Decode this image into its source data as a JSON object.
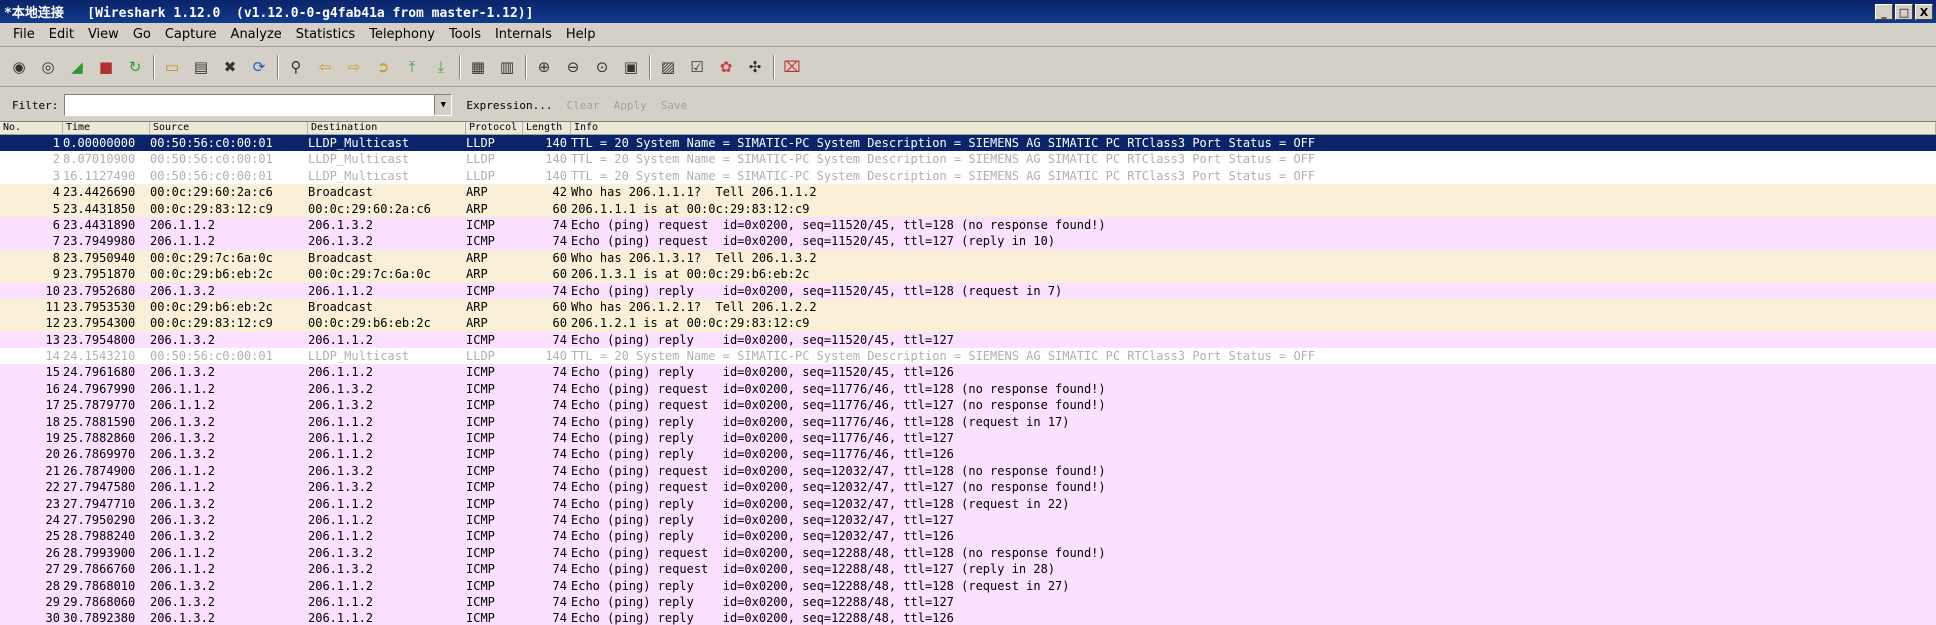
{
  "window": {
    "title": "*本地连接   [Wireshark 1.12.0  (v1.12.0-0-g4fab41a from master-1.12)]",
    "minimize": "_",
    "maximize": "□",
    "close": "X"
  },
  "menu": [
    "File",
    "Edit",
    "View",
    "Go",
    "Capture",
    "Analyze",
    "Statistics",
    "Telephony",
    "Tools",
    "Internals",
    "Help"
  ],
  "toolbar": {
    "icons": [
      "interfaces-icon",
      "options-icon",
      "start-capture-icon",
      "stop-capture-icon",
      "restart-capture-icon",
      "open-file-icon",
      "save-file-icon",
      "close-file-icon",
      "reload-icon",
      "find-icon",
      "go-back-icon",
      "go-forward-icon",
      "go-to-packet-icon",
      "first-packet-icon",
      "last-packet-icon",
      "colorize-icon",
      "autoscroll-icon",
      "zoom-in-icon",
      "zoom-out-icon",
      "normal-size-icon",
      "resize-columns-icon",
      "capture-filters-icon",
      "display-filters-icon",
      "coloring-rules-icon",
      "preferences-icon",
      "help-icon"
    ]
  },
  "filter": {
    "label": "Filter:",
    "value": "",
    "expression": "Expression...",
    "clear": "Clear",
    "apply": "Apply",
    "save": "Save"
  },
  "packet_list": {
    "columns": [
      "No.",
      "Time",
      "Source",
      "Destination",
      "Protocol",
      "Length",
      "Info"
    ],
    "colors": {
      "selected_bg": "#0a246a",
      "selected_fg": "#ffffff",
      "lldp_fg": "#b0b0b0",
      "arp_bg": "#faf0d7",
      "icmp_bg": "#fce0ff"
    },
    "rows": [
      {
        "no": "1",
        "time": "0.00000000",
        "src": "00:50:56:c0:00:01",
        "dst": "LLDP_Multicast",
        "proto": "LLDP",
        "len": "140",
        "info": "TTL = 20 System Name = SIMATIC-PC System Description = SIEMENS AG SIMATIC PC RTClass3 Port Status = OFF",
        "style": "selected"
      },
      {
        "no": "2",
        "time": "8.07010900",
        "src": "00:50:56:c0:00:01",
        "dst": "LLDP_Multicast",
        "proto": "LLDP",
        "len": "140",
        "info": "TTL = 20 System Name = SIMATIC-PC System Description = SIEMENS AG SIMATIC PC RTClass3 Port Status = OFF",
        "style": "lldp"
      },
      {
        "no": "3",
        "time": "16.1127490",
        "src": "00:50:56:c0:00:01",
        "dst": "LLDP_Multicast",
        "proto": "LLDP",
        "len": "140",
        "info": "TTL = 20 System Name = SIMATIC-PC System Description = SIEMENS AG SIMATIC PC RTClass3 Port Status = OFF",
        "style": "lldp"
      },
      {
        "no": "4",
        "time": "23.4426690",
        "src": "00:0c:29:60:2a:c6",
        "dst": "Broadcast",
        "proto": "ARP",
        "len": "42",
        "info": "Who has 206.1.1.1?  Tell 206.1.1.2",
        "style": "arp"
      },
      {
        "no": "5",
        "time": "23.4431850",
        "src": "00:0c:29:83:12:c9",
        "dst": "00:0c:29:60:2a:c6",
        "proto": "ARP",
        "len": "60",
        "info": "206.1.1.1 is at 00:0c:29:83:12:c9",
        "style": "arp"
      },
      {
        "no": "6",
        "time": "23.4431890",
        "src": "206.1.1.2",
        "dst": "206.1.3.2",
        "proto": "ICMP",
        "len": "74",
        "info": "Echo (ping) request  id=0x0200, seq=11520/45, ttl=128 (no response found!)",
        "style": "icmp"
      },
      {
        "no": "7",
        "time": "23.7949980",
        "src": "206.1.1.2",
        "dst": "206.1.3.2",
        "proto": "ICMP",
        "len": "74",
        "info": "Echo (ping) request  id=0x0200, seq=11520/45, ttl=127 (reply in 10)",
        "style": "icmp"
      },
      {
        "no": "8",
        "time": "23.7950940",
        "src": "00:0c:29:7c:6a:0c",
        "dst": "Broadcast",
        "proto": "ARP",
        "len": "60",
        "info": "Who has 206.1.3.1?  Tell 206.1.3.2",
        "style": "arp"
      },
      {
        "no": "9",
        "time": "23.7951870",
        "src": "00:0c:29:b6:eb:2c",
        "dst": "00:0c:29:7c:6a:0c",
        "proto": "ARP",
        "len": "60",
        "info": "206.1.3.1 is at 00:0c:29:b6:eb:2c",
        "style": "arp"
      },
      {
        "no": "10",
        "time": "23.7952680",
        "src": "206.1.3.2",
        "dst": "206.1.1.2",
        "proto": "ICMP",
        "len": "74",
        "info": "Echo (ping) reply    id=0x0200, seq=11520/45, ttl=128 (request in 7)",
        "style": "icmp"
      },
      {
        "no": "11",
        "time": "23.7953530",
        "src": "00:0c:29:b6:eb:2c",
        "dst": "Broadcast",
        "proto": "ARP",
        "len": "60",
        "info": "Who has 206.1.2.1?  Tell 206.1.2.2",
        "style": "arp"
      },
      {
        "no": "12",
        "time": "23.7954300",
        "src": "00:0c:29:83:12:c9",
        "dst": "00:0c:29:b6:eb:2c",
        "proto": "ARP",
        "len": "60",
        "info": "206.1.2.1 is at 00:0c:29:83:12:c9",
        "style": "arp"
      },
      {
        "no": "13",
        "time": "23.7954800",
        "src": "206.1.3.2",
        "dst": "206.1.1.2",
        "proto": "ICMP",
        "len": "74",
        "info": "Echo (ping) reply    id=0x0200, seq=11520/45, ttl=127",
        "style": "icmp"
      },
      {
        "no": "14",
        "time": "24.1543210",
        "src": "00:50:56:c0:00:01",
        "dst": "LLDP_Multicast",
        "proto": "LLDP",
        "len": "140",
        "info": "TTL = 20 System Name = SIMATIC-PC System Description = SIEMENS AG SIMATIC PC RTClass3 Port Status = OFF",
        "style": "lldp"
      },
      {
        "no": "15",
        "time": "24.7961680",
        "src": "206.1.3.2",
        "dst": "206.1.1.2",
        "proto": "ICMP",
        "len": "74",
        "info": "Echo (ping) reply    id=0x0200, seq=11520/45, ttl=126",
        "style": "icmp"
      },
      {
        "no": "16",
        "time": "24.7967990",
        "src": "206.1.1.2",
        "dst": "206.1.3.2",
        "proto": "ICMP",
        "len": "74",
        "info": "Echo (ping) request  id=0x0200, seq=11776/46, ttl=128 (no response found!)",
        "style": "icmp"
      },
      {
        "no": "17",
        "time": "25.7879770",
        "src": "206.1.1.2",
        "dst": "206.1.3.2",
        "proto": "ICMP",
        "len": "74",
        "info": "Echo (ping) request  id=0x0200, seq=11776/46, ttl=127 (no response found!)",
        "style": "icmp"
      },
      {
        "no": "18",
        "time": "25.7881590",
        "src": "206.1.3.2",
        "dst": "206.1.1.2",
        "proto": "ICMP",
        "len": "74",
        "info": "Echo (ping) reply    id=0x0200, seq=11776/46, ttl=128 (request in 17)",
        "style": "icmp"
      },
      {
        "no": "19",
        "time": "25.7882860",
        "src": "206.1.3.2",
        "dst": "206.1.1.2",
        "proto": "ICMP",
        "len": "74",
        "info": "Echo (ping) reply    id=0x0200, seq=11776/46, ttl=127",
        "style": "icmp"
      },
      {
        "no": "20",
        "time": "26.7869970",
        "src": "206.1.3.2",
        "dst": "206.1.1.2",
        "proto": "ICMP",
        "len": "74",
        "info": "Echo (ping) reply    id=0x0200, seq=11776/46, ttl=126",
        "style": "icmp"
      },
      {
        "no": "21",
        "time": "26.7874900",
        "src": "206.1.1.2",
        "dst": "206.1.3.2",
        "proto": "ICMP",
        "len": "74",
        "info": "Echo (ping) request  id=0x0200, seq=12032/47, ttl=128 (no response found!)",
        "style": "icmp"
      },
      {
        "no": "22",
        "time": "27.7947580",
        "src": "206.1.1.2",
        "dst": "206.1.3.2",
        "proto": "ICMP",
        "len": "74",
        "info": "Echo (ping) request  id=0x0200, seq=12032/47, ttl=127 (no response found!)",
        "style": "icmp"
      },
      {
        "no": "23",
        "time": "27.7947710",
        "src": "206.1.3.2",
        "dst": "206.1.1.2",
        "proto": "ICMP",
        "len": "74",
        "info": "Echo (ping) reply    id=0x0200, seq=12032/47, ttl=128 (request in 22)",
        "style": "icmp"
      },
      {
        "no": "24",
        "time": "27.7950290",
        "src": "206.1.3.2",
        "dst": "206.1.1.2",
        "proto": "ICMP",
        "len": "74",
        "info": "Echo (ping) reply    id=0x0200, seq=12032/47, ttl=127",
        "style": "icmp"
      },
      {
        "no": "25",
        "time": "28.7988240",
        "src": "206.1.3.2",
        "dst": "206.1.1.2",
        "proto": "ICMP",
        "len": "74",
        "info": "Echo (ping) reply    id=0x0200, seq=12032/47, ttl=126",
        "style": "icmp"
      },
      {
        "no": "26",
        "time": "28.7993900",
        "src": "206.1.1.2",
        "dst": "206.1.3.2",
        "proto": "ICMP",
        "len": "74",
        "info": "Echo (ping) request  id=0x0200, seq=12288/48, ttl=128 (no response found!)",
        "style": "icmp"
      },
      {
        "no": "27",
        "time": "29.7866760",
        "src": "206.1.1.2",
        "dst": "206.1.3.2",
        "proto": "ICMP",
        "len": "74",
        "info": "Echo (ping) request  id=0x0200, seq=12288/48, ttl=127 (reply in 28)",
        "style": "icmp"
      },
      {
        "no": "28",
        "time": "29.7868010",
        "src": "206.1.3.2",
        "dst": "206.1.1.2",
        "proto": "ICMP",
        "len": "74",
        "info": "Echo (ping) reply    id=0x0200, seq=12288/48, ttl=128 (request in 27)",
        "style": "icmp"
      },
      {
        "no": "29",
        "time": "29.7868060",
        "src": "206.1.3.2",
        "dst": "206.1.1.2",
        "proto": "ICMP",
        "len": "74",
        "info": "Echo (ping) reply    id=0x0200, seq=12288/48, ttl=127",
        "style": "icmp"
      },
      {
        "no": "30",
        "time": "30.7892380",
        "src": "206.1.3.2",
        "dst": "206.1.1.2",
        "proto": "ICMP",
        "len": "74",
        "info": "Echo (ping) reply    id=0x0200, seq=12288/48, ttl=126",
        "style": "icmp"
      }
    ]
  }
}
